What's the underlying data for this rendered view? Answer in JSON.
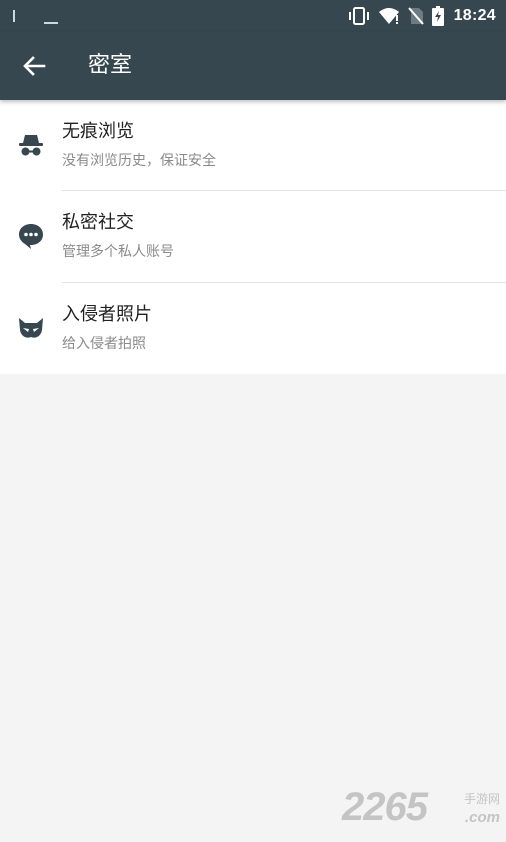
{
  "status_bar": {
    "time": "18:24",
    "icons": [
      "vibrate-icon",
      "wifi-icon",
      "no-sim-icon",
      "battery-charging-icon"
    ]
  },
  "app_bar": {
    "title": "密室",
    "back_icon": "arrow-left-icon"
  },
  "items": [
    {
      "title": "无痕浏览",
      "subtitle": "没有浏览历史，保证安全",
      "icon": "incognito-icon"
    },
    {
      "title": "私密社交",
      "subtitle": "管理多个私人账号",
      "icon": "chat-bubble-icon"
    },
    {
      "title": "入侵者照片",
      "subtitle": "给入侵者拍照",
      "icon": "mask-icon"
    }
  ],
  "watermark": {
    "number": "2265",
    "cn": "手游网",
    "domain": ".com"
  },
  "colors": {
    "app_bar": "#37474f",
    "background": "#f4f4f4",
    "title_text": "#212121",
    "subtitle_text": "#8a8a8a"
  }
}
